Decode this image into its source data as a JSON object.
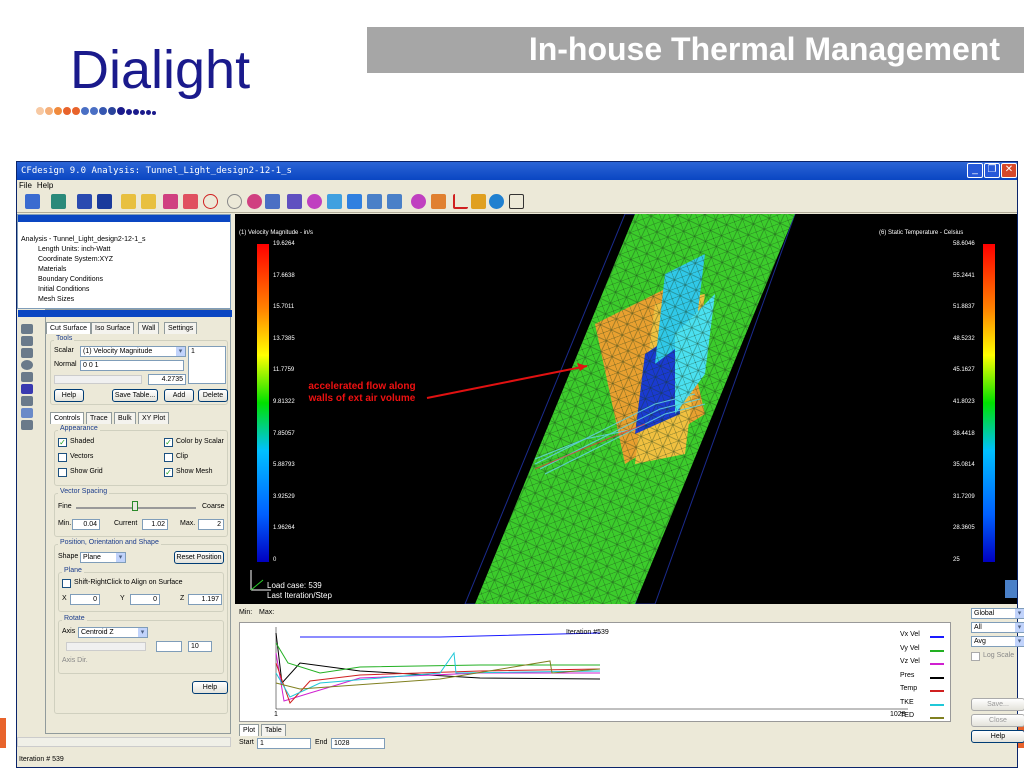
{
  "slide": {
    "logo": "Dialight",
    "title": "In-house Thermal Management"
  },
  "window": {
    "title": "CFdesign 9.0  Analysis: Tunnel_Light_design2-12-1_s",
    "menu": [
      "File",
      "Help"
    ]
  },
  "tree": {
    "items": [
      "Analysis - Tunnel_Light_design2-12-1_s",
      "Length Units: inch-Watt",
      "Coordinate System:XYZ",
      "Materials",
      "Boundary Conditions",
      "Initial Conditions",
      "Mesh Sizes"
    ]
  },
  "controls": {
    "top_tabs": [
      "Cut Surface",
      "Iso Surface",
      "Wall",
      "Settings"
    ],
    "tools_label": "Tools",
    "scalar_label": "Scalar",
    "scalar_value": "(1) Velocity Magnitude",
    "scalar_index": "1",
    "normal_label": "Normal",
    "normal_value": "0 0 1",
    "slider_value": "4.2735",
    "help": "Help",
    "save_table": "Save Table...",
    "add": "Add",
    "delete": "Delete",
    "sub_tabs": [
      "Controls",
      "Trace",
      "Bulk",
      "XY Plot"
    ],
    "appearance_label": "Appearance",
    "shaded": "Shaded",
    "color_by_scalar": "Color by Scalar",
    "vectors": "Vectors",
    "clip": "Clip",
    "show_grid": "Show Grid",
    "show_mesh": "Show Mesh",
    "vector_spacing_label": "Vector Spacing",
    "fine": "Fine",
    "coarse": "Coarse",
    "min_label": "Min.",
    "min_value": "0.04",
    "current_label": "Current",
    "current_value": "1.02",
    "max_label": "Max.",
    "max_value": "2",
    "position_label": "Position, Orientation and Shape",
    "shape_label": "Shape",
    "shape_value": "Plane",
    "reset_position": "Reset Position",
    "plane_label": "Plane",
    "shift_right_click": "Shift-RightClick to Align on Surface",
    "x_label": "X",
    "x_value": "0",
    "y_label": "Y",
    "y_value": "0",
    "z_label": "Z",
    "z_value": "1.197",
    "rotate_label": "Rotate",
    "axis_label": "Axis",
    "axis_value": "Centroid Z",
    "angle_value": "10",
    "axis_dir": "Axis Dir.",
    "help2": "Help"
  },
  "viewport": {
    "left_scale_title": "(1) Velocity Magnitude - in/s",
    "left_scale": [
      "19.6264",
      "17.6638",
      "15.7011",
      "13.7385",
      "11.7759",
      "9.81322",
      "7.85057",
      "5.88793",
      "3.92529",
      "1.96264",
      "0"
    ],
    "right_scale_title": "(6) Static Temperature - Celsius",
    "right_scale": [
      "58.6046",
      "55.2441",
      "51.8837",
      "48.5232",
      "45.1627",
      "41.8023",
      "38.4418",
      "35.0814",
      "31.7209",
      "28.3605",
      "25"
    ],
    "annotation": "accelerated flow along walls of ext air volume",
    "load_case": "Load case: 539",
    "last_iteration": "Last Iteration/Step",
    "accent_red": "#e11111"
  },
  "plot": {
    "min_label": "Min:",
    "max_label": "Max:",
    "iteration_label": "Iteration #539",
    "x_start_tick": "1",
    "x_end_tick": "1028",
    "legend": [
      {
        "name": "Vx Vel",
        "color": "#1a1aff"
      },
      {
        "name": "Vy Vel",
        "color": "#22b022"
      },
      {
        "name": "Vz Vel",
        "color": "#d020d0"
      },
      {
        "name": "Pres",
        "color": "#000000"
      },
      {
        "name": "Temp",
        "color": "#d02020"
      },
      {
        "name": "TKE",
        "color": "#20c8d8"
      },
      {
        "name": "TED",
        "color": "#808020"
      }
    ],
    "dropdown1": "Global",
    "dropdown2": "All",
    "dropdown3": "Avg",
    "log_scale": "Log Scale",
    "save": "Save...",
    "close": "Close",
    "help": "Help",
    "tabs": [
      "Plot",
      "Table"
    ],
    "start_label": "Start",
    "start_value": "1",
    "end_label": "End",
    "end_value": "1028"
  },
  "status": {
    "text": "Iteration # 539"
  }
}
